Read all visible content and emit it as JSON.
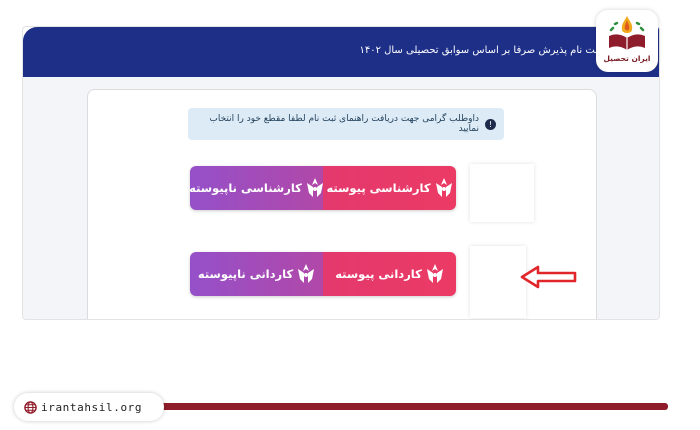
{
  "header": {
    "title": "ثبت نام پذیرش صرفا بر اساس سوابق تحصیلی سال ۱۴۰۲"
  },
  "notice": {
    "icon": "info-icon",
    "text": "داوطلب گرامی جهت دریافت راهنمای ثبت نام لطفا مقطع خود را انتخاب نمایید"
  },
  "buttons": {
    "row1": {
      "pink_label": "کارشناسی پیوسته",
      "purple_label": "کارشناسی ناپیوسته"
    },
    "row2": {
      "pink_label": "کاردانی پیوسته",
      "purple_label": "کاردانی ناپیوسته"
    },
    "icon": "azad-university-logo-icon"
  },
  "annotation": {
    "arrow_icon": "red-arrow-icon",
    "color": "#e0262b"
  },
  "brand": {
    "name": "ایران تحصیل",
    "icon": "book-flame-logo-icon"
  },
  "footer": {
    "url": "irantahsil.org",
    "icon": "globe-icon"
  },
  "colors": {
    "header": "#1e2f88",
    "pink": "#e8386b",
    "purple": "#9a4ec4",
    "notice_bg": "#dcebf6",
    "brand": "#8f1c2a"
  }
}
